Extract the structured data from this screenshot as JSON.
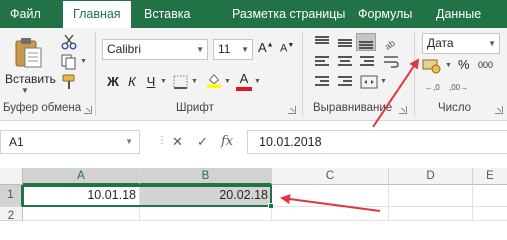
{
  "tabs": [
    {
      "label": "Файл",
      "active": false
    },
    {
      "label": "Главная",
      "active": true
    },
    {
      "label": "Вставка",
      "active": false
    },
    {
      "label": "Разметка страницы",
      "active": false
    },
    {
      "label": "Формулы",
      "active": false
    },
    {
      "label": "Данные",
      "active": false
    }
  ],
  "ribbon": {
    "clipboard": {
      "paste_label": "Вставить",
      "group_label": "Буфер обмена"
    },
    "font": {
      "font_name": "Calibri",
      "font_size": "11",
      "bold": "Ж",
      "italic": "К",
      "underline": "Ч",
      "grow": "A",
      "shrink": "A",
      "group_label": "Шрифт"
    },
    "alignment": {
      "group_label": "Выравнивание"
    },
    "number": {
      "format_value": "Дата",
      "percent": "%",
      "comma": "000",
      "group_label": "Число"
    }
  },
  "formula_bar": {
    "name_box": "A1",
    "cancel": "✕",
    "enter": "✓",
    "fx": "fx",
    "value": "10.01.2018"
  },
  "grid": {
    "columns": [
      "A",
      "B",
      "C",
      "D",
      "E"
    ],
    "rows": [
      "1",
      "2"
    ],
    "cells": {
      "A1": "10.01.18",
      "B1": "20.02.18"
    }
  },
  "colors": {
    "brand": "#217346",
    "annotation_arrow": "#e0363e"
  }
}
